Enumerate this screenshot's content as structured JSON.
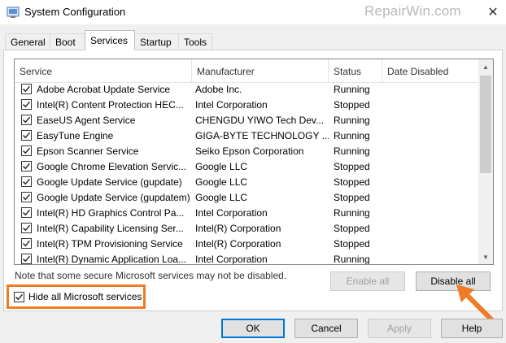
{
  "window": {
    "title": "System Configuration",
    "watermark": "RepairWin.com",
    "close_glyph": "✕",
    "app_icon": "msconfig-icon"
  },
  "tabs": [
    {
      "label": "General",
      "active": false
    },
    {
      "label": "Boot",
      "active": false
    },
    {
      "label": "Services",
      "active": true
    },
    {
      "label": "Startup",
      "active": false
    },
    {
      "label": "Tools",
      "active": false
    }
  ],
  "list": {
    "columns": [
      "Service",
      "Manufacturer",
      "Status",
      "Date Disabled"
    ],
    "rows": [
      {
        "checked": true,
        "service": "Adobe Acrobat Update Service",
        "manufacturer": "Adobe Inc.",
        "status": "Running",
        "date_disabled": ""
      },
      {
        "checked": true,
        "service": "Intel(R) Content Protection HEC...",
        "manufacturer": "Intel Corporation",
        "status": "Stopped",
        "date_disabled": ""
      },
      {
        "checked": true,
        "service": "EaseUS Agent Service",
        "manufacturer": "CHENGDU YIWO Tech Dev...",
        "status": "Running",
        "date_disabled": ""
      },
      {
        "checked": true,
        "service": "EasyTune Engine",
        "manufacturer": "GIGA-BYTE TECHNOLOGY ...",
        "status": "Running",
        "date_disabled": ""
      },
      {
        "checked": true,
        "service": "Epson Scanner Service",
        "manufacturer": "Seiko Epson Corporation",
        "status": "Running",
        "date_disabled": ""
      },
      {
        "checked": true,
        "service": "Google Chrome Elevation Servic...",
        "manufacturer": "Google LLC",
        "status": "Stopped",
        "date_disabled": ""
      },
      {
        "checked": true,
        "service": "Google Update Service (gupdate)",
        "manufacturer": "Google LLC",
        "status": "Stopped",
        "date_disabled": ""
      },
      {
        "checked": true,
        "service": "Google Update Service (gupdatem)",
        "manufacturer": "Google LLC",
        "status": "Stopped",
        "date_disabled": ""
      },
      {
        "checked": true,
        "service": "Intel(R) HD Graphics Control Pa...",
        "manufacturer": "Intel Corporation",
        "status": "Running",
        "date_disabled": ""
      },
      {
        "checked": true,
        "service": "Intel(R) Capability Licensing Ser...",
        "manufacturer": "Intel(R) Corporation",
        "status": "Stopped",
        "date_disabled": ""
      },
      {
        "checked": true,
        "service": "Intel(R) TPM Provisioning Service",
        "manufacturer": "Intel(R) Corporation",
        "status": "Stopped",
        "date_disabled": ""
      },
      {
        "checked": true,
        "service": "Intel(R) Dynamic Application Loa...",
        "manufacturer": "Intel Corporation",
        "status": "Running",
        "date_disabled": ""
      }
    ]
  },
  "note": "Note that some secure Microsoft services may not be disabled.",
  "hide_ms": {
    "label": "Hide all Microsoft services",
    "checked": true
  },
  "buttons": {
    "enable_all": "Enable all",
    "disable_all": "Disable all",
    "ok": "OK",
    "cancel": "Cancel",
    "apply": "Apply",
    "help": "Help"
  },
  "colors": {
    "highlight": "#f07b24",
    "accent": "#0078d7"
  }
}
